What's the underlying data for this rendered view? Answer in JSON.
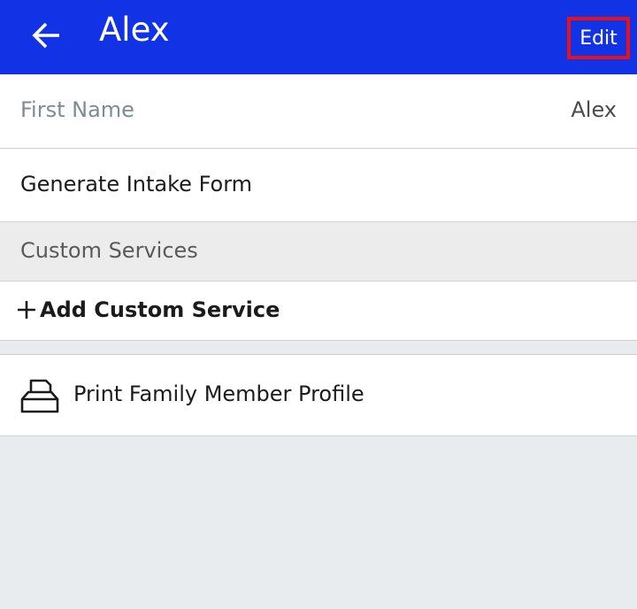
{
  "header": {
    "title": "Alex",
    "edit_label": "Edit",
    "back_icon": "arrow-left-icon",
    "background_color": "#1232e6"
  },
  "first_name": {
    "label": "First Name",
    "value": "Alex"
  },
  "intake": {
    "label": "Generate Intake Form"
  },
  "custom_services": {
    "section_label": "Custom Services",
    "add_label": "Add Custom Service",
    "add_icon": "plus-icon"
  },
  "print": {
    "label": "Print Family Member Profile",
    "icon": "printer-icon"
  },
  "colors": {
    "highlight_border": "#e8101a",
    "page_background": "#e9ecef"
  }
}
